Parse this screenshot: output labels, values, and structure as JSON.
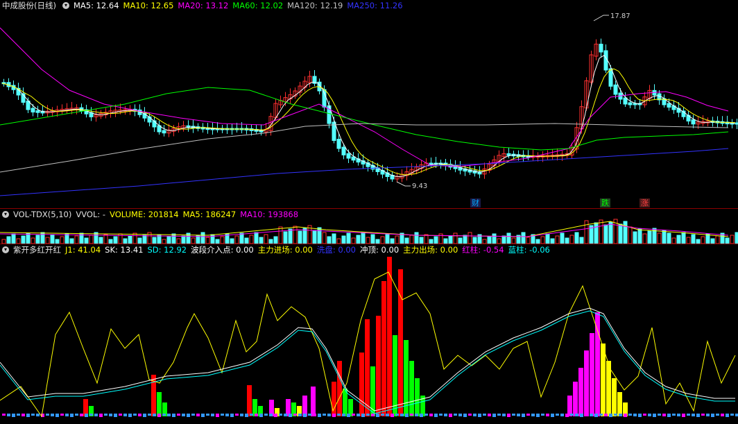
{
  "main": {
    "title": "中成股份(日线)",
    "ma": [
      {
        "label": "MA5: 12.64",
        "color": "#ffffff"
      },
      {
        "label": "MA10: 12.65",
        "color": "#ffff00"
      },
      {
        "label": "MA20: 13.12",
        "color": "#ff00ff"
      },
      {
        "label": "MA60: 12.02",
        "color": "#00ff00"
      },
      {
        "label": "MA120: 12.19",
        "color": "#c0c0c0"
      },
      {
        "label": "MA250: 11.26",
        "color": "#3333ff"
      }
    ],
    "high_label": "17.87",
    "low_label": "9.43",
    "markers": [
      {
        "text": "财",
        "color": "#00aaff",
        "bg": "#1a1a4a"
      },
      {
        "text": "跌",
        "color": "#00ff00",
        "bg": "#224422"
      },
      {
        "text": "涨",
        "color": "#ff4040",
        "bg": "#4a1a1a"
      }
    ]
  },
  "volume": {
    "title": "VOL-TDX(5,10)",
    "items": [
      {
        "label": "VVOL: -",
        "color": "#e0e0e0"
      },
      {
        "label": "VOLUME: 201814",
        "color": "#ffff00"
      },
      {
        "label": "MA5: 186247",
        "color": "#ffff00"
      },
      {
        "label": "MA10: 193868",
        "color": "#ff00ff"
      }
    ]
  },
  "indicator": {
    "title": "紫开多红开红",
    "items": [
      {
        "label": "J1: 41.04",
        "color": "#ffff00"
      },
      {
        "label": "SK: 13.41",
        "color": "#ffffff"
      },
      {
        "label": "SD: 12.92",
        "color": "#00ffff"
      },
      {
        "label": "波段介入点: 0.00",
        "color": "#ffffff"
      },
      {
        "label": "主力进场: 0.00",
        "color": "#ffff00"
      },
      {
        "label": "洗盘: 0.00",
        "color": "#3333ff"
      },
      {
        "label": "冲顶: 0.00",
        "color": "#ffffff"
      },
      {
        "label": "主力出场: 0.00",
        "color": "#ffff00"
      },
      {
        "label": "红柱: -0.54",
        "color": "#ff00ff"
      },
      {
        "label": "蓝柱: -0.06",
        "color": "#00ffff"
      }
    ]
  },
  "colors": {
    "up": "#ff3030",
    "down": "#54ffff",
    "separator": "#8b0000"
  }
}
